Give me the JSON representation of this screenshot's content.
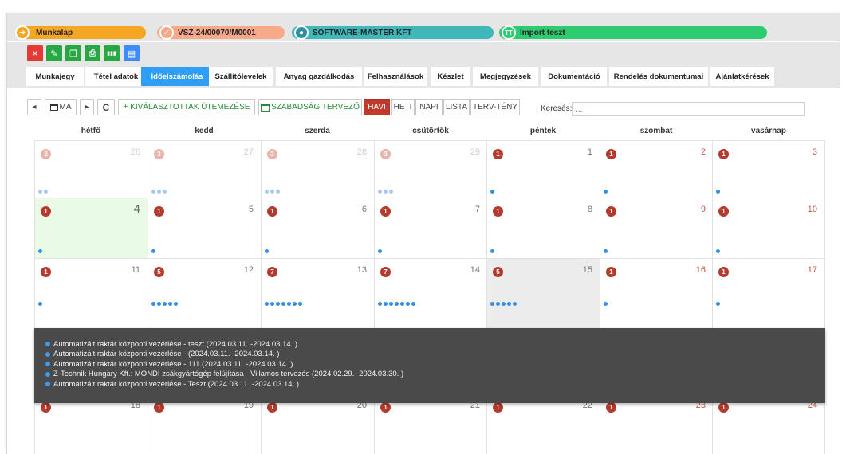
{
  "header": {
    "pills": [
      {
        "icon": "➜",
        "label": "Munkalap",
        "color": "#f5a623"
      },
      {
        "icon": "✓",
        "label": "VSZ-24/00070/M0001",
        "color": "#f7a98a"
      },
      {
        "icon": "●",
        "label": "SOFTWARE-MASTER KFT",
        "color": "#3fb8ba"
      },
      {
        "icon": "TT",
        "label": "Import teszt",
        "color": "#2ecc71"
      }
    ]
  },
  "actions": [
    {
      "name": "close-button",
      "icon": "✕",
      "color": "red"
    },
    {
      "name": "edit-button",
      "icon": "✎",
      "color": "green"
    },
    {
      "name": "copy-button",
      "icon": "❐",
      "color": "green"
    },
    {
      "name": "print-button",
      "icon": "⎙",
      "color": "green"
    },
    {
      "name": "barcode-button",
      "icon": "▮▮▮",
      "color": "green"
    },
    {
      "name": "save-button",
      "icon": "▤",
      "color": "blue"
    }
  ],
  "tabs": [
    {
      "label": "Munkajegy",
      "active": false
    },
    {
      "label": "Tétel adatok",
      "active": false
    },
    {
      "label": "Időelszámolás",
      "active": true
    },
    {
      "label": "Szállítólevelek",
      "active": false
    },
    {
      "label": "Anyag gazdálkodás",
      "active": false
    },
    {
      "label": "Felhasználások",
      "active": false
    },
    {
      "label": "Készlet",
      "active": false
    },
    {
      "label": "Megjegyzések",
      "active": false
    },
    {
      "label": "Dokumentáció",
      "active": false
    },
    {
      "label": "Rendelés dokumentumai",
      "active": false
    },
    {
      "label": "Ajánlatkérések",
      "active": false
    }
  ],
  "toolbar": {
    "prev": "◂",
    "today": "MA",
    "next": "▸",
    "refresh": "C",
    "schedule": "+ KIVÁLASZTOTTAK ÜTEMEZÉSE",
    "holiday": "SZABADSÁG TERVEZŐ",
    "views": [
      "HAVI",
      "HETI",
      "NAPI",
      "LISTA",
      "TERV-TÉNY"
    ],
    "active_view": "HAVI",
    "search_label": "Keresés:",
    "search_placeholder": "..."
  },
  "days": [
    "hétfő",
    "kedd",
    "szerda",
    "csütörtök",
    "péntek",
    "szombat",
    "vasárnap"
  ],
  "weeks": [
    [
      {
        "day": "26",
        "count": "2",
        "dots": 2,
        "other": true
      },
      {
        "day": "27",
        "count": "3",
        "dots": 3,
        "other": true
      },
      {
        "day": "28",
        "count": "3",
        "dots": 3,
        "other": true
      },
      {
        "day": "29",
        "count": "3",
        "dots": 3,
        "other": true
      },
      {
        "day": "1",
        "count": "1",
        "dots": 1
      },
      {
        "day": "2",
        "count": "1",
        "dots": 1,
        "weekend": true
      },
      {
        "day": "3",
        "count": "1",
        "dots": 1,
        "weekend": true
      }
    ],
    [
      {
        "day": "4",
        "count": "1",
        "dots": 1,
        "today": true
      },
      {
        "day": "5",
        "count": "1",
        "dots": 1
      },
      {
        "day": "6",
        "count": "1",
        "dots": 1
      },
      {
        "day": "7",
        "count": "1",
        "dots": 1
      },
      {
        "day": "8",
        "count": "1",
        "dots": 1
      },
      {
        "day": "9",
        "count": "1",
        "dots": 1,
        "weekend": true
      },
      {
        "day": "10",
        "count": "1",
        "dots": 1,
        "weekend": true
      }
    ],
    [
      {
        "day": "11",
        "count": "1",
        "dots": 1
      },
      {
        "day": "12",
        "count": "5",
        "dots": 5
      },
      {
        "day": "13",
        "count": "7",
        "dots": 7
      },
      {
        "day": "14",
        "count": "7",
        "dots": 7
      },
      {
        "day": "15",
        "count": "5",
        "dots": 5,
        "selected": true
      },
      {
        "day": "16",
        "count": "1",
        "dots": 1,
        "weekend": true
      },
      {
        "day": "17",
        "count": "1",
        "dots": 1,
        "weekend": true
      }
    ],
    [
      {
        "day": "18",
        "count": "1",
        "dots": 1
      },
      {
        "day": "19",
        "count": "1",
        "dots": 1
      },
      {
        "day": "20",
        "count": "1",
        "dots": 1
      },
      {
        "day": "21",
        "count": "1",
        "dots": 1
      },
      {
        "day": "22",
        "count": "1",
        "dots": 1
      },
      {
        "day": "23",
        "count": "1",
        "dots": 1,
        "weekend": true
      },
      {
        "day": "24",
        "count": "1",
        "dots": 1,
        "weekend": true
      }
    ]
  ],
  "popup_events": [
    "Automatizált raktár központi vezérlése - teszt (2024.03.11. -2024.03.14. )",
    "Automatizált raktár központi vezérlése - (2024.03.11. -2024.03.14. )",
    "Automatizált raktár központi vezérlése - 111 (2024.03.11. -2024.03.14. )",
    "Z-Technik Hungary Kft.: MONDI zsákgyártógép felújítása - Villamos tervezés (2024.02.29. -2024.03.30. )",
    "Automatizált raktár központi vezérlése - Teszt (2024.03.11. -2024.03.14. )"
  ]
}
